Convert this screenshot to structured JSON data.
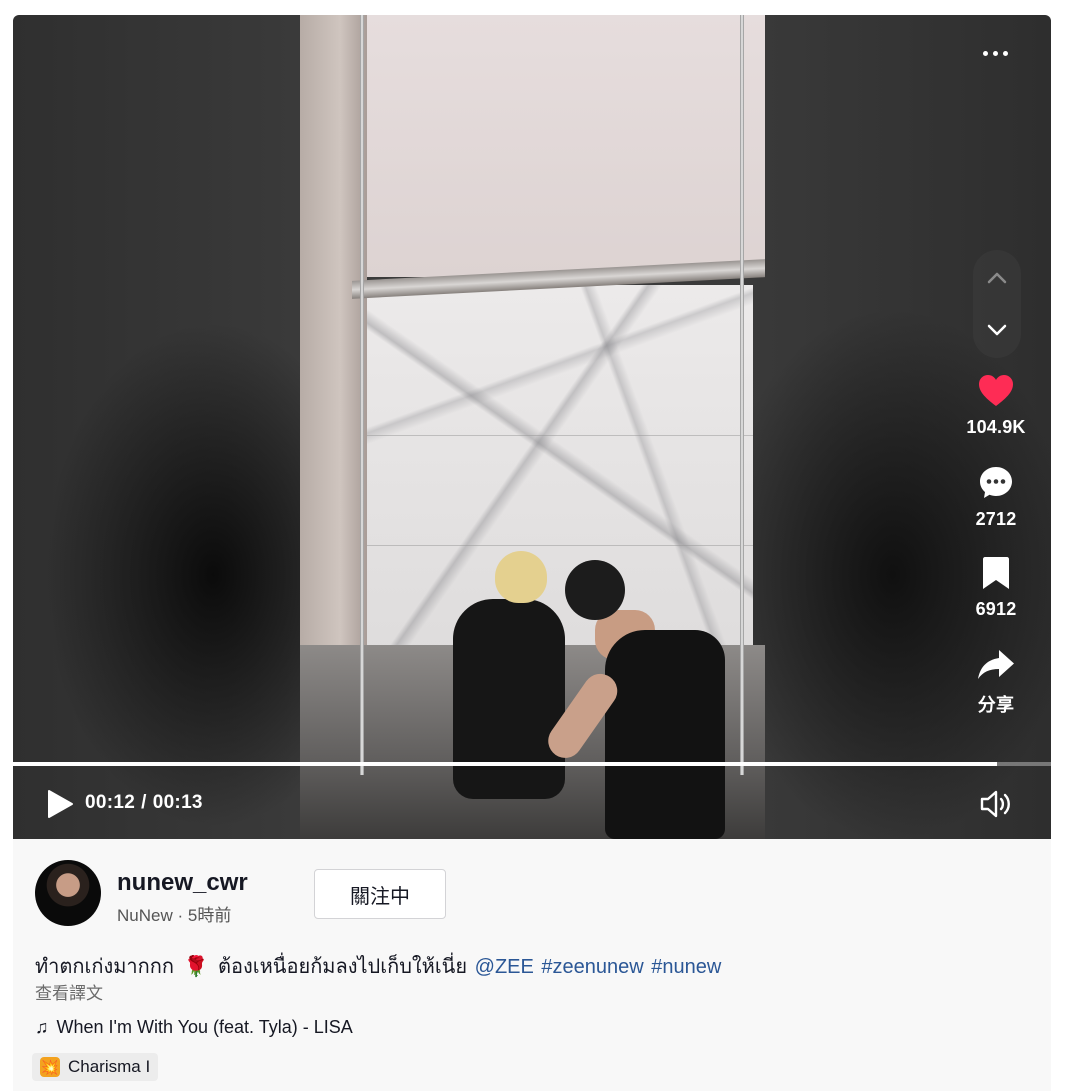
{
  "player": {
    "current_time": "00:12",
    "separator": "/",
    "total_time": "00:13",
    "progress": 0.948
  },
  "actions": {
    "likes": "104.9K",
    "comments": "2712",
    "saves": "6912",
    "share_label": "分享"
  },
  "author": {
    "username": "nunew_cwr",
    "display_name": "NuNew",
    "dot": "·",
    "posted": "5時前"
  },
  "follow_button": "關注中",
  "caption": {
    "text_before": "ทำตกเก่งมากกก",
    "emoji": "🌹",
    "text_after": "ต้องเหนื่อยก้มลงไปเก็บให้เนี่ย",
    "mention": "@ZEE",
    "hashtags": [
      "#zeenunew",
      "#nunew"
    ]
  },
  "translate_link": "查看譯文",
  "music": {
    "note": "♫",
    "title": "When I'm With You (feat. Tyla) - LISA"
  },
  "effect": {
    "icon": "💥",
    "label": "Charisma I"
  },
  "colors": {
    "heart": "#fe2c55",
    "link": "#2b5796"
  }
}
